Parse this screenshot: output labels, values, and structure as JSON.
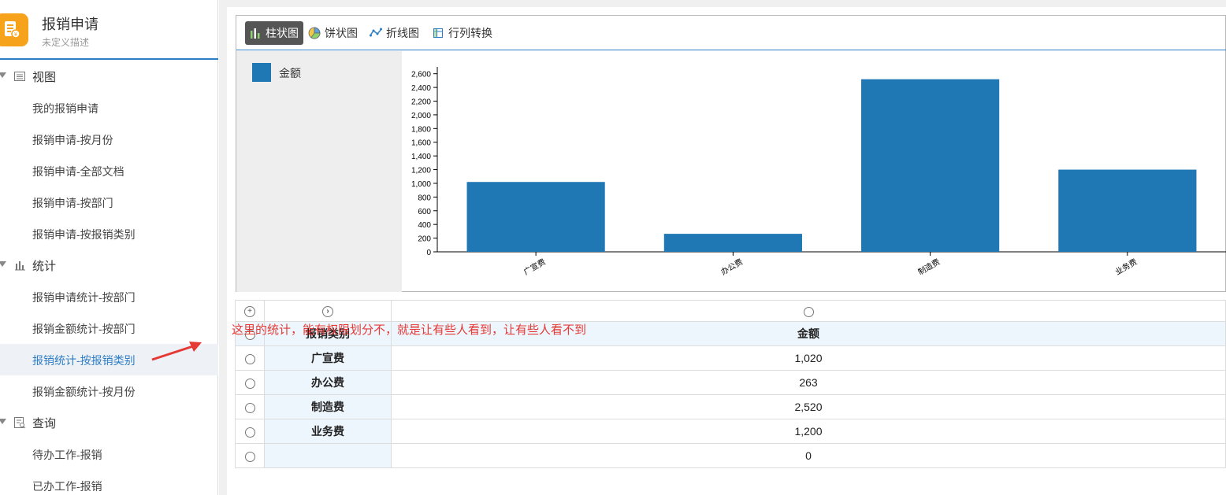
{
  "app": {
    "title": "报销申请",
    "description": "未定义描述",
    "logo_color": "#f7a21b"
  },
  "sidebar": {
    "groups": [
      {
        "label": "视图",
        "icon": "list-view-icon",
        "items": [
          "我的报销申请",
          "报销申请-按月份",
          "报销申请-全部文档",
          "报销申请-按部门",
          "报销申请-按报销类别"
        ]
      },
      {
        "label": "统计",
        "icon": "bar-stats-icon",
        "items": [
          "报销申请统计-按部门",
          "报销金额统计-按部门",
          "报销统计-按报销类别",
          "报销金额统计-按月份"
        ]
      },
      {
        "label": "查询",
        "icon": "query-doc-icon",
        "items": [
          "待办工作-报销",
          "已办工作-报销"
        ]
      }
    ],
    "active_item": "报销统计-按报销类别",
    "active_color": "#2d7dc6"
  },
  "toolbar": {
    "bar": "柱状图",
    "pie": "饼状图",
    "line": "折线图",
    "transpose": "行列转换",
    "active": "bar"
  },
  "legend": {
    "label": "金额",
    "color": "#1f77b4"
  },
  "chart_data": {
    "type": "bar",
    "categories": [
      "广宣费",
      "办公费",
      "制造费",
      "业务费"
    ],
    "series": [
      {
        "name": "金额",
        "values": [
          1020,
          263,
          2520,
          1200
        ],
        "color": "#1f77b4"
      }
    ],
    "ylim": [
      0,
      2700
    ],
    "yticks": [
      0,
      200,
      400,
      600,
      800,
      1000,
      1200,
      1400,
      1600,
      1800,
      2000,
      2200,
      2400,
      2600
    ],
    "ytick_labels": [
      "0",
      "200",
      "400",
      "600",
      "800",
      "1,000",
      "1,200",
      "1,400",
      "1,600",
      "1,800",
      "2,000",
      "2,200",
      "2,400",
      "2,600"
    ],
    "grid": false,
    "xlabel": "",
    "ylabel": "",
    "title": ""
  },
  "table": {
    "headers": {
      "category": "报销类别",
      "amount": "金额"
    },
    "rows": [
      {
        "category": "广宣费",
        "amount": "1,020"
      },
      {
        "category": "办公费",
        "amount": "263"
      },
      {
        "category": "制造费",
        "amount": "2,520"
      },
      {
        "category": "业务费",
        "amount": "1,200"
      },
      {
        "category": "",
        "amount": "0"
      }
    ]
  },
  "annotation": {
    "text": "这里的统计，能有权限划分不，就是让有些人看到，让有些人看不到",
    "color": "#e53935"
  }
}
